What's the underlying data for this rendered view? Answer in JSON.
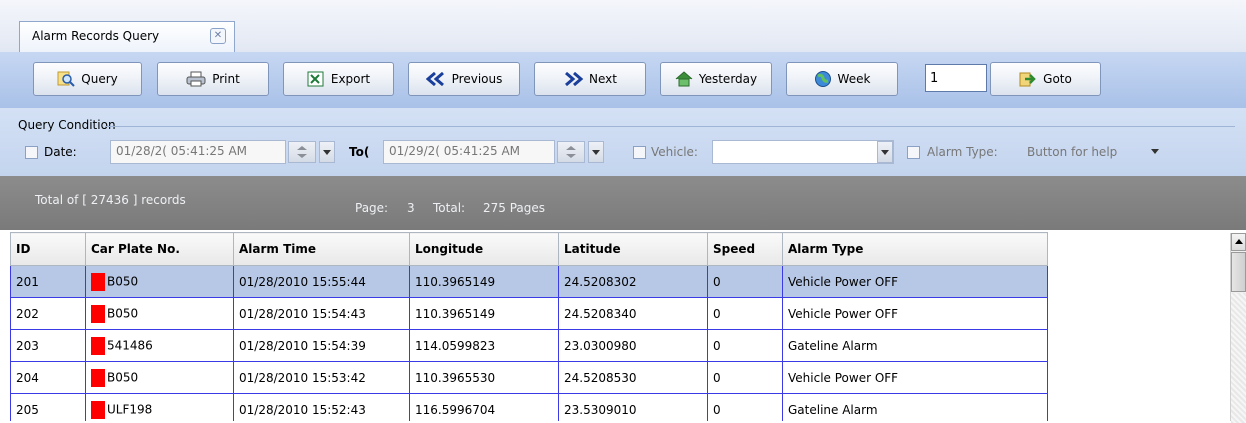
{
  "tab": {
    "title": "Alarm Records Query"
  },
  "toolbar": {
    "query": "Query",
    "print": "Print",
    "export": "Export",
    "previous": "Previous",
    "next": "Next",
    "yesterday": "Yesterday",
    "week": "Week",
    "page_value": "1",
    "goto": "Goto"
  },
  "condition": {
    "group_label": "Query Condition",
    "date_label": "Date:",
    "from_value": "01/28/2( 05:41:25 AM",
    "to_label": "To(",
    "to_value": "01/29/2( 05:41:25 AM",
    "vehicle_label": "Vehicle:",
    "vehicle_value": "",
    "alarm_type_label": "Alarm Type:",
    "alarm_type_value": "Button for help"
  },
  "summary": {
    "total_text": "Total of [ 27436 ] records",
    "page_label": "Page:",
    "page_value": "3",
    "total_label": "Total:",
    "total_pages": "275 Pages"
  },
  "table": {
    "columns": [
      "ID",
      "Car Plate No.",
      "Alarm Time",
      "Longitude",
      "Latitude",
      "Speed",
      "Alarm Type"
    ],
    "rows": [
      [
        "201",
        "B050",
        "01/28/2010 15:55:44",
        "110.3965149",
        "24.5208302",
        "0",
        "Vehicle Power OFF"
      ],
      [
        "202",
        "B050",
        "01/28/2010 15:54:43",
        "110.3965149",
        "24.5208340",
        "0",
        "Vehicle Power OFF"
      ],
      [
        "203",
        "541486",
        "01/28/2010 15:54:39",
        "114.0599823",
        "23.0300980",
        "0",
        "Gateline Alarm"
      ],
      [
        "204",
        "B050",
        "01/28/2010 15:53:42",
        "110.3965530",
        "24.5208530",
        "0",
        "Vehicle Power OFF"
      ],
      [
        "205",
        "ULF198",
        "01/28/2010 15:52:43",
        "116.5996704",
        "23.5309010",
        "0",
        "Gateline Alarm"
      ]
    ]
  },
  "colors": {
    "selected_row": "#b7c8e6",
    "grid_border": "#3a3ae6",
    "toolbar": "#b6cbed",
    "summary_bar": "#848484",
    "redaction": "#ff0000"
  }
}
